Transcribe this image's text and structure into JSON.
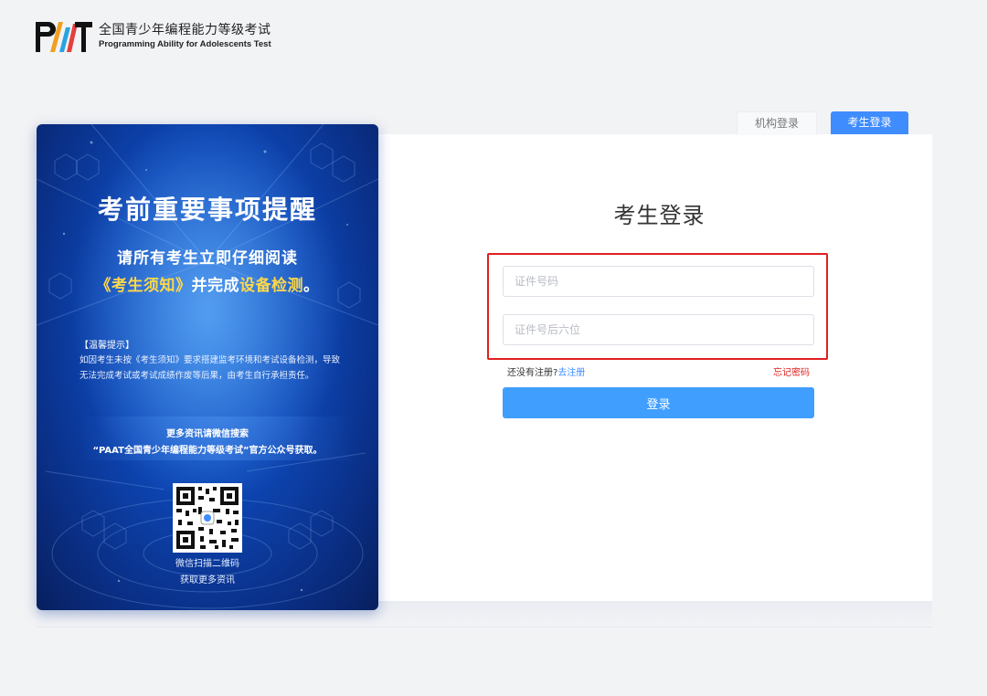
{
  "logo": {
    "mark": "PAAT",
    "title_cn": "全国青少年编程能力等级考试",
    "title_en": "Programming Ability for Adolescents Test"
  },
  "tabs": {
    "org": "机构登录",
    "student": "考生登录",
    "active": "student"
  },
  "poster": {
    "title": "考前重要事项提醒",
    "line1": "请所有考生立即仔细阅读",
    "line2_part1": "《考生须知》",
    "line2_part2": "并完成",
    "line2_part3": "设备检测",
    "line2_part4": "。",
    "tip_title": "【温馨提示】",
    "tip_body": "如因考生未按《考生须知》要求搭建监考环境和考试设备检测，导致无法完成考试或考试成绩作废等后果，由考生自行承担责任。",
    "info1": "更多资讯请微信搜索",
    "info2": "“PAAT全国青少年编程能力等级考试”官方公众号获取。",
    "qr_caption1": "微信扫描二维码",
    "qr_caption2": "获取更多资讯"
  },
  "login": {
    "title": "考生登录",
    "id_placeholder": "证件号码",
    "id_value": "",
    "pw_placeholder": "证件号后六位",
    "pw_value": "",
    "no_account": "还没有注册?",
    "register_link": "去注册",
    "forgot": "忘记密码",
    "submit": "登录"
  },
  "colors": {
    "primary": "#409eff",
    "tab_active": "#3f8cff",
    "highlight": "#e02020",
    "poster_blue": "#0d48b8",
    "accent_yellow": "#ffd84a"
  }
}
